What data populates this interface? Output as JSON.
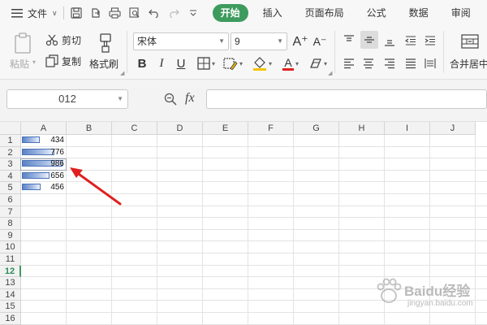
{
  "menubar": {
    "file_label": "文件",
    "tabs": [
      {
        "label": "开始",
        "active": true
      },
      {
        "label": "插入",
        "active": false
      },
      {
        "label": "页面布局",
        "active": false
      },
      {
        "label": "公式",
        "active": false
      },
      {
        "label": "数据",
        "active": false
      },
      {
        "label": "审阅",
        "active": false
      }
    ]
  },
  "ribbon": {
    "paste_label": "粘贴",
    "cut_label": "剪切",
    "copy_label": "复制",
    "format_painter_label": "格式刷",
    "font_name": "宋体",
    "font_size": "9",
    "grow_font": "A⁺",
    "shrink_font": "A⁻",
    "bold": "B",
    "italic": "I",
    "underline": "U",
    "font_color_letter": "A",
    "merge_label": "合并居中",
    "accent_color": "#3e9b5e",
    "fill_color": "#f5c400",
    "font_color": "#e02020"
  },
  "formula_bar": {
    "cell_reference": "012",
    "fx_label": "fx",
    "formula_value": ""
  },
  "grid": {
    "columns": [
      "A",
      "B",
      "C",
      "D",
      "E",
      "F",
      "G",
      "H",
      "I",
      "J"
    ],
    "rows": [
      "1",
      "2",
      "3",
      "4",
      "5",
      "6",
      "7",
      "8",
      "9",
      "10",
      "11",
      "12",
      "13",
      "14",
      "15",
      "16"
    ],
    "active_row": "12",
    "cells": [
      {
        "address": "A1",
        "value": "434",
        "bar_fraction": 0.44
      },
      {
        "address": "A2",
        "value": "776",
        "bar_fraction": 0.79
      },
      {
        "address": "A3",
        "value": "986",
        "bar_fraction": 1.0
      },
      {
        "address": "A4",
        "value": "656",
        "bar_fraction": 0.67
      },
      {
        "address": "A5",
        "value": "456",
        "bar_fraction": 0.46
      }
    ],
    "databar_color": "#5b82c6"
  },
  "annotation": {
    "arrow_color": "#e02020"
  },
  "watermark": {
    "text": "Baidu经验",
    "subtext": "jingyan.baidu.com"
  }
}
